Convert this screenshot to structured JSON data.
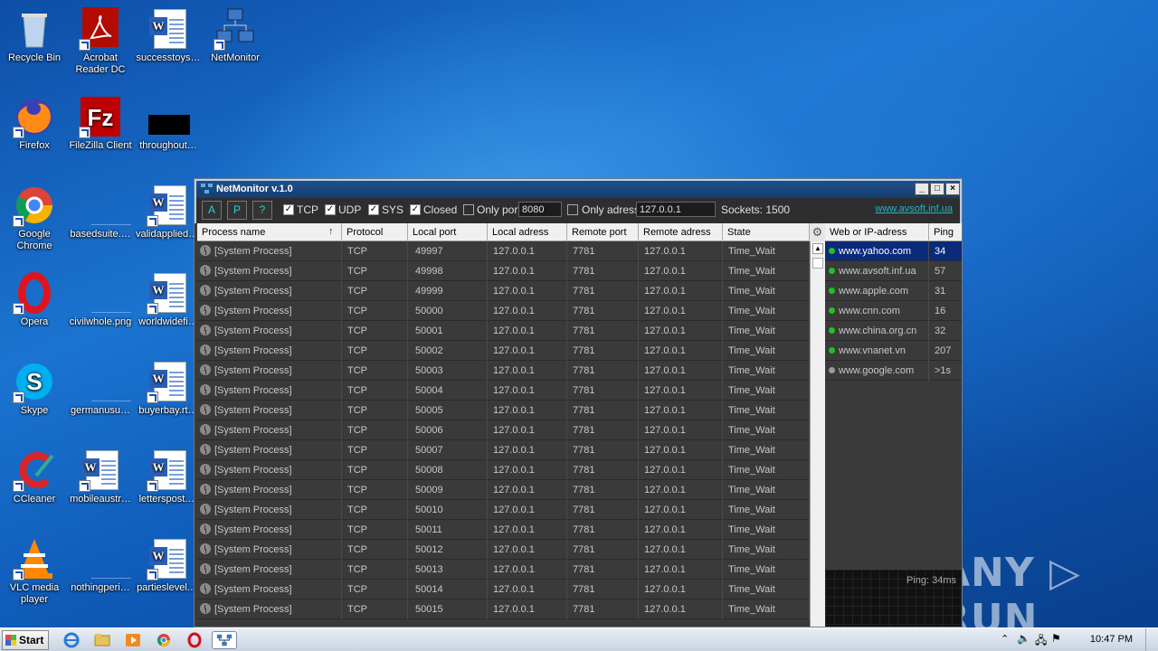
{
  "desktop": {
    "icons": [
      {
        "label": "Recycle Bin",
        "icon": "recycle-bin-icon"
      },
      {
        "label": "Acrobat Reader DC",
        "icon": "acrobat-icon"
      },
      {
        "label": "successtoys…",
        "icon": "word-doc-icon"
      },
      {
        "label": "NetMonitor",
        "icon": "network-icon"
      },
      {
        "label": "Firefox",
        "icon": "firefox-icon"
      },
      {
        "label": "FileZilla Client",
        "icon": "filezilla-icon"
      },
      {
        "label": "throughout…",
        "icon": "black-file-icon"
      },
      {
        "label": "Google Chrome",
        "icon": "chrome-icon"
      },
      {
        "label": "basedsuite.…",
        "icon": "blank-file-icon"
      },
      {
        "label": "validapplied.…",
        "icon": "word-doc-icon"
      },
      {
        "label": "Opera",
        "icon": "opera-icon"
      },
      {
        "label": "civilwhole.png",
        "icon": "blank-file-icon"
      },
      {
        "label": "worldwidefi…",
        "icon": "word-doc-icon"
      },
      {
        "label": "Skype",
        "icon": "skype-icon"
      },
      {
        "label": "germanusu…",
        "icon": "blank-file-icon"
      },
      {
        "label": "buyerbay.rt…",
        "icon": "word-doc-icon"
      },
      {
        "label": "CCleaner",
        "icon": "ccleaner-icon"
      },
      {
        "label": "mobileaustr…",
        "icon": "word-doc-icon"
      },
      {
        "label": "letterspost.…",
        "icon": "word-doc-icon"
      },
      {
        "label": "VLC media player",
        "icon": "vlc-icon"
      },
      {
        "label": "nothingperi…",
        "icon": "blank-file-icon"
      },
      {
        "label": "partieslevel.…",
        "icon": "word-doc-icon"
      }
    ]
  },
  "window": {
    "title": "NetMonitor v.1.0",
    "buttons": {
      "a": "A",
      "p": "P",
      "help": "?"
    },
    "filters": {
      "tcp": {
        "label": "TCP",
        "checked": true
      },
      "udp": {
        "label": "UDP",
        "checked": true
      },
      "sys": {
        "label": "SYS",
        "checked": true
      },
      "closed": {
        "label": "Closed",
        "checked": true
      },
      "only_port": {
        "label": "Only port:",
        "checked": false,
        "value": "8080"
      },
      "only_address": {
        "label": "Only adress:",
        "checked": false,
        "value": "127.0.0.1"
      }
    },
    "sockets": "Sockets: 1500",
    "link": "www.avsoft.inf.ua"
  },
  "table": {
    "columns": [
      "Process name",
      "Protocol",
      "Local port",
      "Local adress",
      "Remote port",
      "Remote adress",
      "State"
    ],
    "rows": [
      [
        "[System Process]",
        "TCP",
        "49997",
        "127.0.0.1",
        "7781",
        "127.0.0.1",
        "Time_Wait"
      ],
      [
        "[System Process]",
        "TCP",
        "49998",
        "127.0.0.1",
        "7781",
        "127.0.0.1",
        "Time_Wait"
      ],
      [
        "[System Process]",
        "TCP",
        "49999",
        "127.0.0.1",
        "7781",
        "127.0.0.1",
        "Time_Wait"
      ],
      [
        "[System Process]",
        "TCP",
        "50000",
        "127.0.0.1",
        "7781",
        "127.0.0.1",
        "Time_Wait"
      ],
      [
        "[System Process]",
        "TCP",
        "50001",
        "127.0.0.1",
        "7781",
        "127.0.0.1",
        "Time_Wait"
      ],
      [
        "[System Process]",
        "TCP",
        "50002",
        "127.0.0.1",
        "7781",
        "127.0.0.1",
        "Time_Wait"
      ],
      [
        "[System Process]",
        "TCP",
        "50003",
        "127.0.0.1",
        "7781",
        "127.0.0.1",
        "Time_Wait"
      ],
      [
        "[System Process]",
        "TCP",
        "50004",
        "127.0.0.1",
        "7781",
        "127.0.0.1",
        "Time_Wait"
      ],
      [
        "[System Process]",
        "TCP",
        "50005",
        "127.0.0.1",
        "7781",
        "127.0.0.1",
        "Time_Wait"
      ],
      [
        "[System Process]",
        "TCP",
        "50006",
        "127.0.0.1",
        "7781",
        "127.0.0.1",
        "Time_Wait"
      ],
      [
        "[System Process]",
        "TCP",
        "50007",
        "127.0.0.1",
        "7781",
        "127.0.0.1",
        "Time_Wait"
      ],
      [
        "[System Process]",
        "TCP",
        "50008",
        "127.0.0.1",
        "7781",
        "127.0.0.1",
        "Time_Wait"
      ],
      [
        "[System Process]",
        "TCP",
        "50009",
        "127.0.0.1",
        "7781",
        "127.0.0.1",
        "Time_Wait"
      ],
      [
        "[System Process]",
        "TCP",
        "50010",
        "127.0.0.1",
        "7781",
        "127.0.0.1",
        "Time_Wait"
      ],
      [
        "[System Process]",
        "TCP",
        "50011",
        "127.0.0.1",
        "7781",
        "127.0.0.1",
        "Time_Wait"
      ],
      [
        "[System Process]",
        "TCP",
        "50012",
        "127.0.0.1",
        "7781",
        "127.0.0.1",
        "Time_Wait"
      ],
      [
        "[System Process]",
        "TCP",
        "50013",
        "127.0.0.1",
        "7781",
        "127.0.0.1",
        "Time_Wait"
      ],
      [
        "[System Process]",
        "TCP",
        "50014",
        "127.0.0.1",
        "7781",
        "127.0.0.1",
        "Time_Wait"
      ],
      [
        "[System Process]",
        "TCP",
        "50015",
        "127.0.0.1",
        "7781",
        "127.0.0.1",
        "Time_Wait"
      ]
    ]
  },
  "sites": {
    "columns": [
      "Web or IP-adress",
      "Ping"
    ],
    "rows": [
      {
        "host": "www.yahoo.com",
        "ping": "34",
        "status": "#22c022",
        "selected": true
      },
      {
        "host": "www.avsoft.inf.ua",
        "ping": "57",
        "status": "#22c022"
      },
      {
        "host": "www.apple.com",
        "ping": "31",
        "status": "#22c022"
      },
      {
        "host": "www.cnn.com",
        "ping": "16",
        "status": "#22c022"
      },
      {
        "host": "www.china.org.cn",
        "ping": "32",
        "status": "#22c022"
      },
      {
        "host": "www.vnanet.vn",
        "ping": "207",
        "status": "#22c022"
      },
      {
        "host": "www.google.com",
        "ping": ">1s",
        "status": "#9a9a9a"
      }
    ],
    "ping_label": "Ping: 34ms"
  },
  "watermark": "ANY ▷ RUN",
  "taskbar": {
    "start": "Start",
    "clock": "10:47 PM"
  }
}
